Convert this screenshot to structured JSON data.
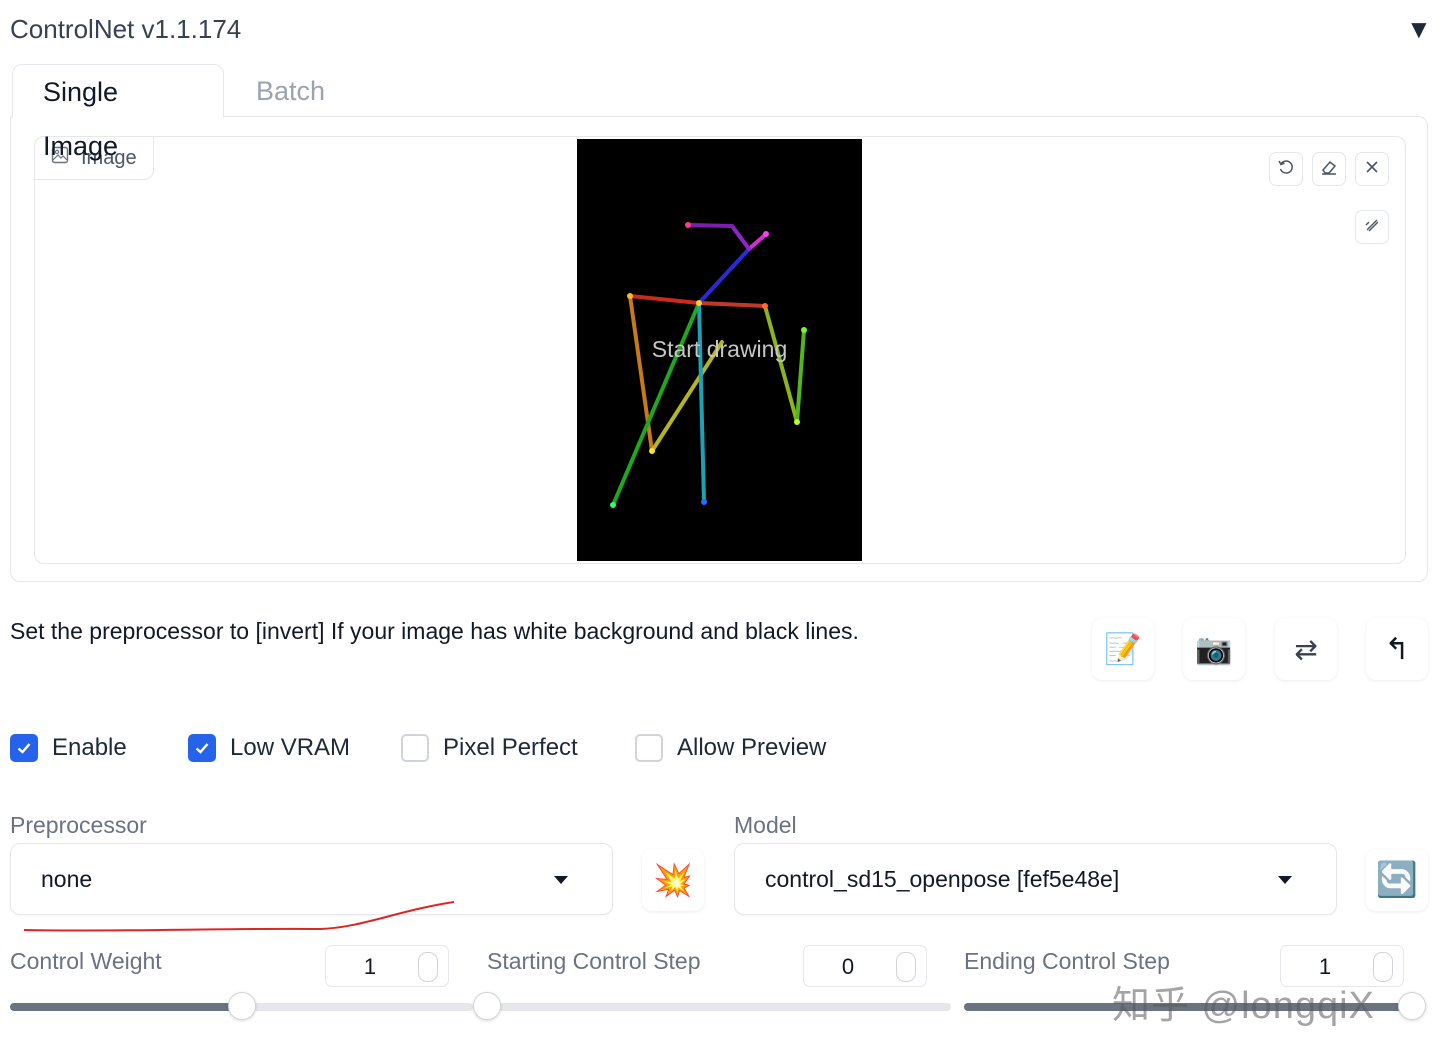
{
  "header": {
    "title": "ControlNet v1.1.174",
    "toggle_icon": "▼"
  },
  "tabs": [
    {
      "label": "Single Image",
      "active": true
    },
    {
      "label": "Batch",
      "active": false
    }
  ],
  "image_panel": {
    "label": "Image",
    "canvas_overlay_text": "Start drawing",
    "tools": [
      "undo-icon",
      "eraser-icon",
      "close-icon",
      "brush-icon"
    ]
  },
  "hint": "Set the preprocessor to [invert] If your image has white background and black lines.",
  "action_buttons": [
    {
      "icon": "memo-icon",
      "glyph": "📝"
    },
    {
      "icon": "camera-icon",
      "glyph": "📷"
    },
    {
      "icon": "swap-icon",
      "glyph": "⇄"
    },
    {
      "icon": "send-dimensions-icon",
      "glyph": "↰"
    }
  ],
  "checkboxes": [
    {
      "label": "Enable",
      "checked": true
    },
    {
      "label": "Low VRAM",
      "checked": true
    },
    {
      "label": "Pixel Perfect",
      "checked": false
    },
    {
      "label": "Allow Preview",
      "checked": false
    }
  ],
  "preprocessor": {
    "label": "Preprocessor",
    "value": "none",
    "run_icon": "💥"
  },
  "model": {
    "label": "Model",
    "value": "control_sd15_openpose [fef5e48e]",
    "refresh_icon": "🔄"
  },
  "sliders": [
    {
      "label": "Control Weight",
      "value": "1",
      "fraction": 0.5
    },
    {
      "label": "Starting Control Step",
      "value": "0",
      "fraction": 0.0
    },
    {
      "label": "Ending Control Step",
      "value": "1",
      "fraction": 1.0
    }
  ],
  "watermark": "知乎 @longqiX",
  "colors": {
    "accent": "#2563eb",
    "canvas_bg": "#000000",
    "annotation_red": "#dc2626"
  }
}
